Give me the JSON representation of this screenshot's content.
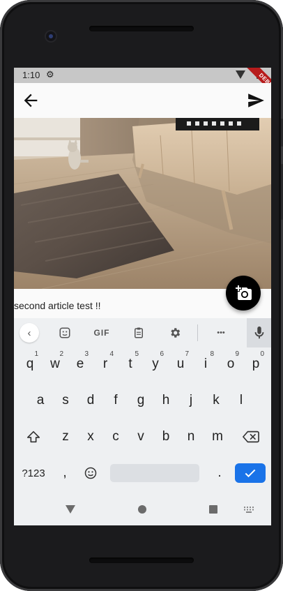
{
  "status_bar": {
    "time": "1:10",
    "debug_banner": "DEBUG"
  },
  "app_bar": {
    "back_icon": "arrow-back-icon",
    "send_icon": "send-icon"
  },
  "post": {
    "caption": "second article test !!",
    "photo_icon": "add-a-photo-icon"
  },
  "keyboard": {
    "toolbar": {
      "collapse": "‹",
      "sticker_icon": "sticker-icon",
      "gif": "GIF",
      "clipboard_icon": "clipboard-icon",
      "settings_icon": "settings-icon",
      "more": "•••",
      "mic_icon": "mic-icon"
    },
    "row1": [
      {
        "k": "q",
        "h": "1"
      },
      {
        "k": "w",
        "h": "2"
      },
      {
        "k": "e",
        "h": "3"
      },
      {
        "k": "r",
        "h": "4"
      },
      {
        "k": "t",
        "h": "5"
      },
      {
        "k": "y",
        "h": "6"
      },
      {
        "k": "u",
        "h": "7"
      },
      {
        "k": "i",
        "h": "8"
      },
      {
        "k": "o",
        "h": "9"
      },
      {
        "k": "p",
        "h": "0"
      }
    ],
    "row2": [
      "a",
      "s",
      "d",
      "f",
      "g",
      "h",
      "j",
      "k",
      "l"
    ],
    "row3": [
      "z",
      "x",
      "c",
      "v",
      "b",
      "n",
      "m"
    ],
    "symbols": "?123",
    "comma": ",",
    "period": ".",
    "shift_icon": "shift-icon",
    "backspace_icon": "backspace-icon",
    "emoji_icon": "emoji-icon",
    "enter_icon": "check-icon"
  },
  "colors": {
    "accent": "#1a73e8",
    "fab": "#000000",
    "debug": "#b71c1c"
  }
}
